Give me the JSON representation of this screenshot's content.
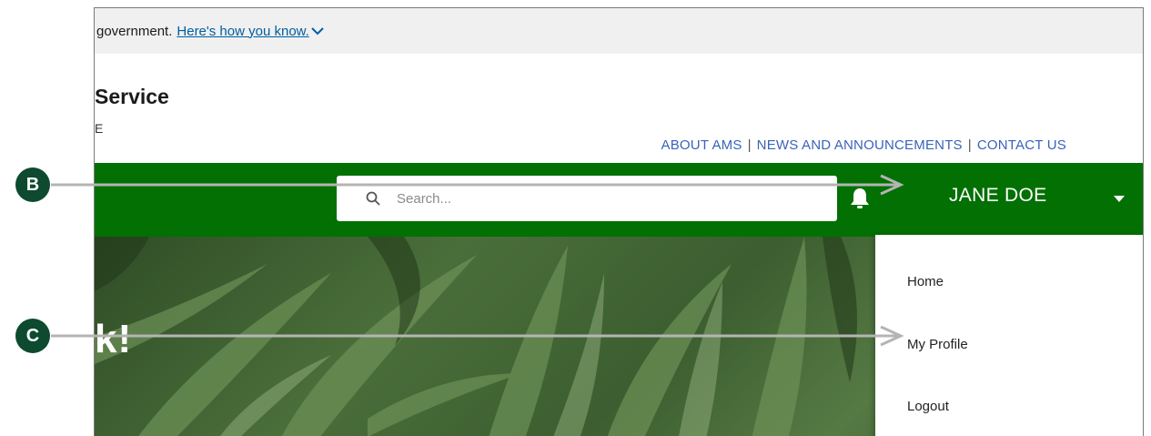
{
  "gov_banner": {
    "text": "government.",
    "link": "Here's how you know.",
    "chevron_icon": "chevron-down-icon"
  },
  "header": {
    "agency_name": "Service",
    "agency_sub": "E"
  },
  "top_links": [
    {
      "label": "ABOUT AMS"
    },
    {
      "label": "NEWS AND ANNOUNCEMENTS"
    },
    {
      "label": "CONTACT US"
    }
  ],
  "top_links_separator": "|",
  "navbar": {
    "search_placeholder": "Search...",
    "search_icon": "search-icon",
    "bell_icon": "bell-icon",
    "user_name": "JANE DOE",
    "caret_icon": "caret-down-icon"
  },
  "hero": {
    "text": "k!"
  },
  "user_menu": {
    "items": [
      {
        "label": "Home"
      },
      {
        "label": "My Profile"
      },
      {
        "label": "Logout"
      }
    ]
  },
  "callouts": [
    {
      "label": "B"
    },
    {
      "label": "C"
    }
  ],
  "colors": {
    "nav_green": "#027002",
    "callout_green": "#0d4a2f",
    "link_blue": "#3a63b8",
    "arrow_gray": "#b4b4b4"
  }
}
